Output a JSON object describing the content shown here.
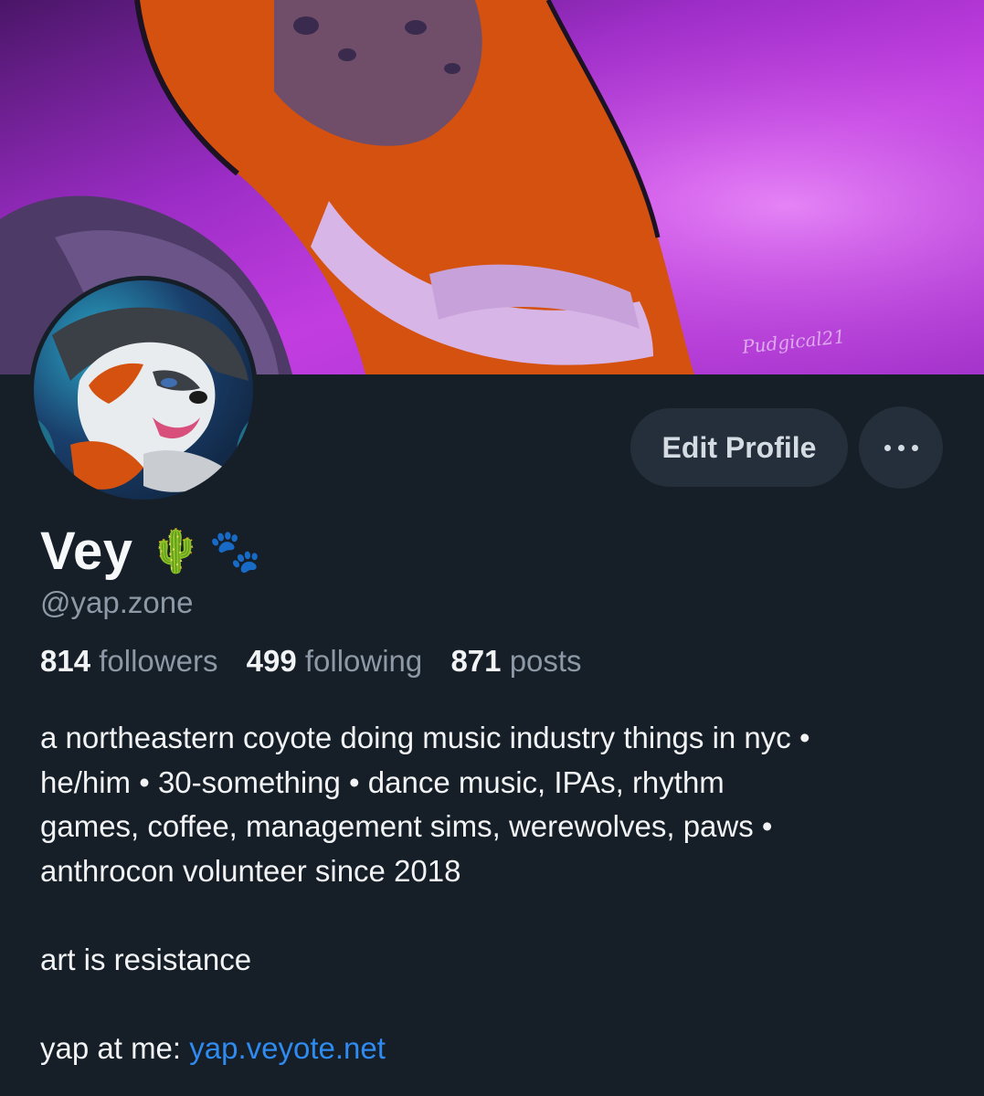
{
  "banner": {
    "watermark": "Pudgical21"
  },
  "profile": {
    "display_name": "Vey",
    "name_emoji_1": "🌵",
    "name_emoji_2": "🐾",
    "handle": "@yap.zone",
    "stats": {
      "followers_count": "814",
      "followers_label": "followers",
      "following_count": "499",
      "following_label": "following",
      "posts_count": "871",
      "posts_label": "posts"
    },
    "bio": {
      "line1": "a northeastern coyote doing music industry things in nyc •",
      "line2": "he/him • 30-something • dance music, IPAs, rhythm",
      "line3": "games, coffee, management sims, werewolves, paws •",
      "line4": "anthrocon volunteer since 2018",
      "line5": "art is resistance",
      "link_prefix": "yap at me: ",
      "link_text": "yap.veyote.net"
    }
  },
  "actions": {
    "edit_profile_label": "Edit Profile",
    "more_icon": "ellipsis-icon"
  },
  "colors": {
    "background": "#161e27",
    "button_bg": "#242f3b",
    "muted_text": "#8d99a6",
    "link": "#2f8bf0"
  }
}
